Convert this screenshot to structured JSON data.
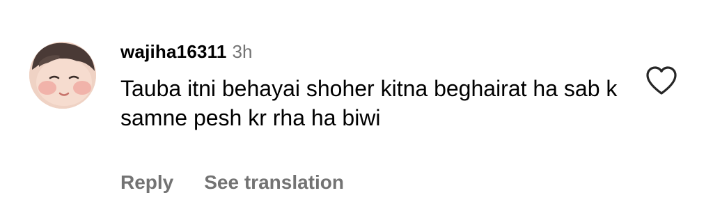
{
  "comment": {
    "username": "wajiha16311",
    "time": "3h",
    "text": "Tauba itni behayai shoher kitna beghairat ha sab k samne pesh kr rha ha biwi",
    "avatar_icon": "avatar-photo",
    "like_icon": "heart-outline-icon"
  },
  "actions": {
    "reply_label": "Reply",
    "translate_label": "See translation"
  },
  "colors": {
    "text": "#000000",
    "muted": "#737373",
    "background": "#ffffff"
  }
}
